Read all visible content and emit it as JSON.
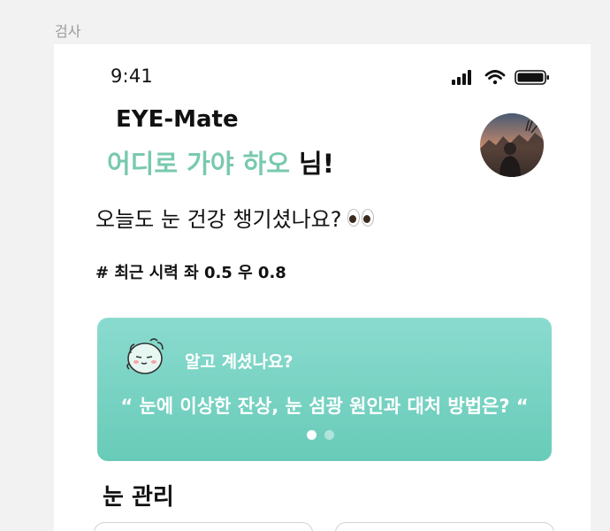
{
  "frame": {
    "label": "검사"
  },
  "status_bar": {
    "time": "9:41",
    "icons": [
      "cellular-signal-icon",
      "wifi-icon",
      "battery-icon"
    ]
  },
  "header": {
    "app_title": "EYE-Mate",
    "user_name": "어디로 가야 하오",
    "name_suffix": " 님!",
    "avatar": "profile-photo"
  },
  "main": {
    "subtitle": "오늘도 눈 건강 챙기셨나요?",
    "subtitle_emoji": "eyes",
    "recent_vision": "# 최근 시력 좌 0.5 우 0.8"
  },
  "tip_card": {
    "heading": "알고 계셨나요?",
    "quote": "“ 눈에 이상한 잔상, 눈 섬광 원인과 대처 방법은? “",
    "page_count": 2,
    "active_page": 1,
    "colors": {
      "top": "#8adbcf",
      "bottom": "#68cbb8"
    }
  },
  "eye_care": {
    "title": "눈 관리"
  },
  "colors": {
    "accent": "#79c9ae",
    "text": "#111111",
    "frame_label": "#9a9a9a"
  }
}
